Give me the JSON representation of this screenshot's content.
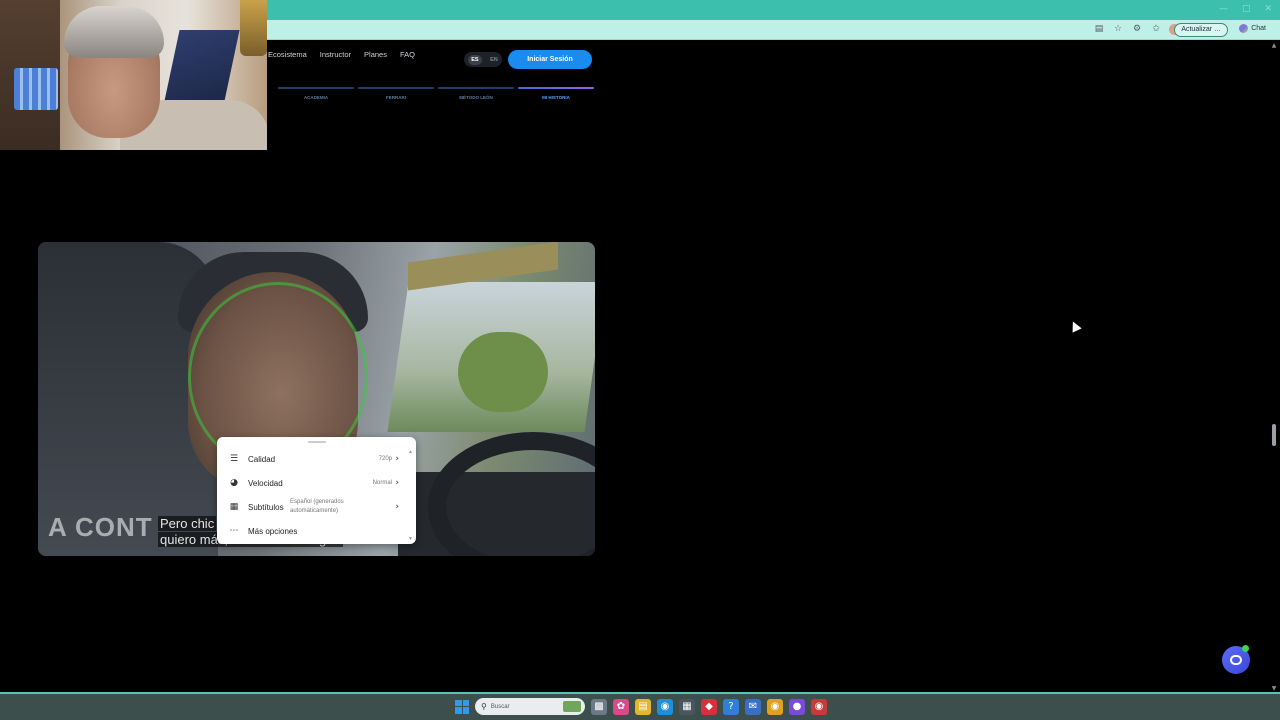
{
  "browser": {
    "update_label": "Actualizar …",
    "chat_label": "Chat"
  },
  "site": {
    "nav": [
      "Ecosistema",
      "Instructor",
      "Planes",
      "FAQ"
    ],
    "lang": [
      "ES",
      "EN"
    ],
    "login_label": "Iniciar Sesión",
    "section_tabs": [
      "ACADEMIA",
      "FERRARI",
      "MÉTODO LEÓN",
      "MI HISTORIA"
    ],
    "active_tab": "MI HISTORIA"
  },
  "video": {
    "overlay_text": "A CONT",
    "caption_line1": "Pero chic",
    "caption_line2": "quiero más, esto no es el lugar.",
    "settings": {
      "quality_label": "Calidad",
      "quality_value": "720p",
      "speed_label": "Velocidad",
      "speed_value": "Normal",
      "subtitles_label": "Subtítulos",
      "subtitles_value": "Español (generados automáticamente)",
      "more_label": "Más opciones"
    }
  },
  "taskbar": {
    "search_placeholder": "Buscar"
  },
  "colors": {
    "accent": "#1a8cf0",
    "titlebar": "#3dbfad",
    "chat": "#4b58ee"
  }
}
